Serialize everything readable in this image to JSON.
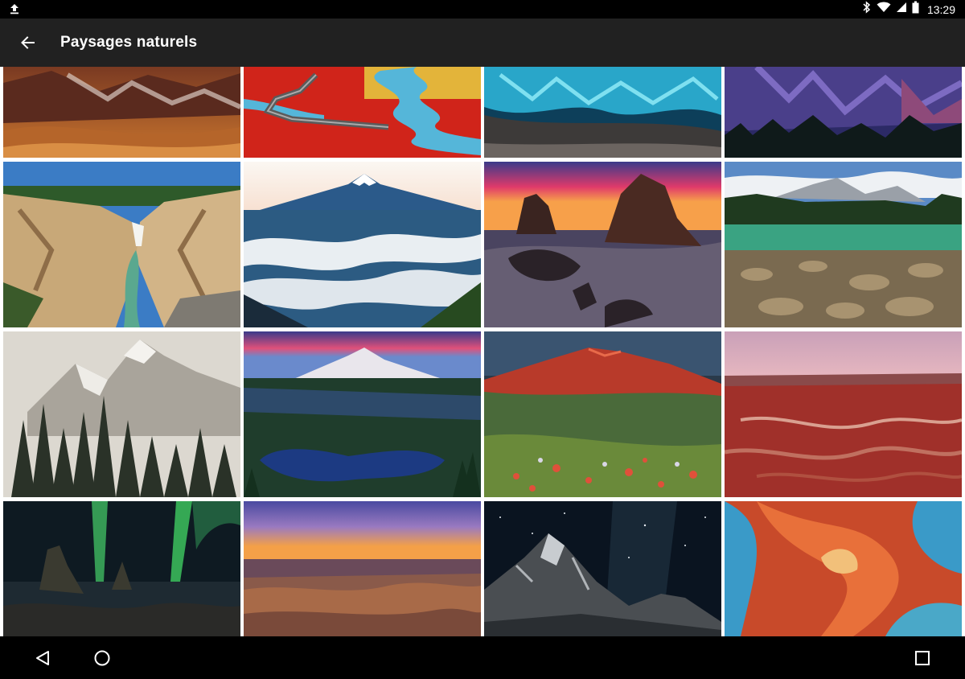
{
  "status_bar": {
    "time": "13:29",
    "icons": [
      "upload-icon",
      "bluetooth-icon",
      "wifi-icon",
      "signal-icon",
      "battery-icon"
    ]
  },
  "app_bar": {
    "title": "Paysages naturels",
    "back_icon": "arrow-back-icon"
  },
  "gallery": {
    "rows": 4,
    "columns": 4,
    "items": [
      "mountain-hills-photo",
      "red-wetland-boardwalk-photo",
      "ice-cave-photo",
      "purple-mountain-photo",
      "yellowstone-canyon-photo",
      "mount-fuji-clouds-photo",
      "sea-stacks-sunset-photo",
      "mountain-lake-photo",
      "snowy-peak-forest-photo",
      "mount-rainier-lake-photo",
      "mount-st-helens-wildflowers-photo",
      "red-canyon-photo",
      "aurora-coast-photo",
      "grand-canyon-sunset-photo",
      "milky-way-peak-photo",
      "antelope-canyon-photo"
    ]
  },
  "nav_bar": {
    "icons": [
      "nav-back-icon",
      "nav-home-icon",
      "nav-recents-icon"
    ]
  },
  "colors": {
    "status_bar": "#000000",
    "app_bar": "#212121",
    "nav_bar": "#000000",
    "grid_gap": "#ffffff"
  }
}
